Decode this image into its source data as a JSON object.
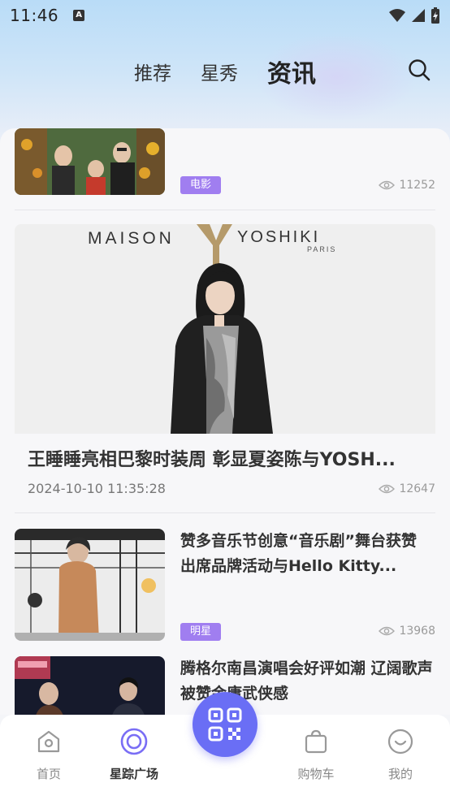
{
  "status_bar": {
    "time": "11:46",
    "notif_letter": "A"
  },
  "tabs": [
    {
      "label": "推荐",
      "active": false
    },
    {
      "label": "星秀",
      "active": false
    },
    {
      "label": "资讯",
      "active": true
    }
  ],
  "feed": {
    "item0": {
      "badge": "电影",
      "views": "11252"
    },
    "item1": {
      "image_text_brand_left": "MAISON",
      "image_text_brand_right": "YOSHIKI",
      "image_text_city": "PARIS",
      "title": "王睡睡亮相巴黎时装周 彰显夏姿陈与YOSH...",
      "date": "2024-10-10 11:35:28",
      "views": "12647"
    },
    "item2": {
      "title": "赞多音乐节创意“音乐剧”舞台获赞 出席品牌活动与Hello Kitty...",
      "badge": "明星",
      "views": "13968"
    },
    "item3": {
      "title": "腾格尔南昌演唱会好评如潮 辽阔歌声被赞金庸武侠感"
    }
  },
  "bottom_nav": [
    {
      "label": "首页",
      "icon": "home-icon",
      "active": false
    },
    {
      "label": "星踪广场",
      "icon": "star-plaza-icon",
      "active": true
    },
    {
      "label": "购物车",
      "icon": "cart-icon",
      "active": false
    },
    {
      "label": "我的",
      "icon": "profile-icon",
      "active": false
    }
  ],
  "colors": {
    "accent": "#6a6ef5",
    "badge": "#a07ef0"
  }
}
